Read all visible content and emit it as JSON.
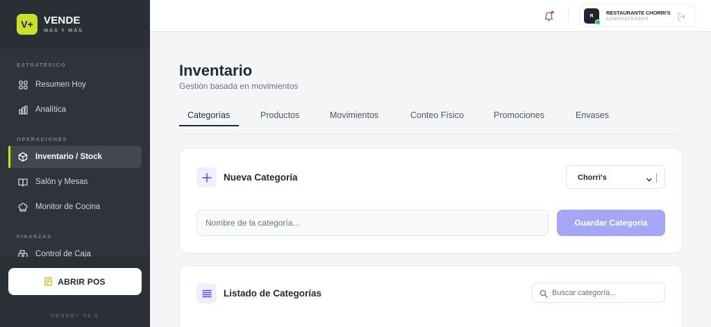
{
  "brand": {
    "logo_text": "V+",
    "name": "VENDE",
    "tagline": "MÁS Y MÁS"
  },
  "sidebar": {
    "sections": [
      {
        "title": "ESTRATÉGICO"
      },
      {
        "title": "OPERACIONES"
      },
      {
        "title": "FINANZAS"
      }
    ],
    "items": [
      {
        "label": "Resumen Hoy",
        "icon": "grid-icon"
      },
      {
        "label": "Analítica",
        "icon": "bar-chart-icon"
      },
      {
        "label": "Inventario / Stock",
        "icon": "box-icon",
        "active": true
      },
      {
        "label": "Salón y Mesas",
        "icon": "book-open-icon"
      },
      {
        "label": "Monitor de Cocina",
        "icon": "chef-hat-icon"
      },
      {
        "label": "Control de Caja",
        "icon": "cash-register-icon"
      }
    ],
    "pos_button": "ABRIR POS",
    "version": "VENDE+ V2.0"
  },
  "topbar": {
    "user": {
      "initial": "R",
      "name": "RESTAURANTE CHORRI'S",
      "role": "ADMINISTRADOR"
    }
  },
  "page": {
    "title": "Inventario",
    "subtitle": "Gestión basada en movimientos",
    "tabs": [
      {
        "label": "Categorías",
        "active": true
      },
      {
        "label": "Productos"
      },
      {
        "label": "Movimientos"
      },
      {
        "label": "Conteo Físico"
      },
      {
        "label": "Promociones"
      },
      {
        "label": "Envases"
      }
    ]
  },
  "new_category": {
    "title": "Nueva Categoría",
    "select_value": "Chorri's",
    "input_placeholder": "Nombre de la categoría...",
    "save_label": "Guardar Categoría"
  },
  "category_list": {
    "title": "Listado de Categorías",
    "search_placeholder": "Buscar categoría..."
  },
  "colors": {
    "accent_lime": "#c8e02a",
    "sidebar_bg": "#2f343c",
    "primary_soft": "#a5a6f6",
    "icon_indigo": "#4f46e5",
    "online": "#22c55e",
    "notification": "#ef4444"
  }
}
